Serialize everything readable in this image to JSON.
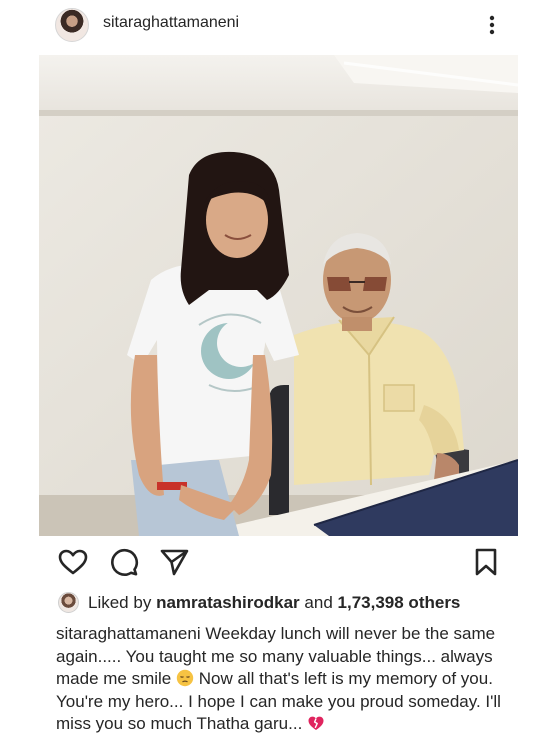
{
  "post": {
    "username": "sitaraghattamaneni"
  },
  "likes": {
    "prefix": "Liked by",
    "user": "namratashirodkar",
    "middle": "and",
    "count": "1,73,398 others"
  },
  "caption": {
    "username": "sitaraghattamaneni",
    "text_1": " Weekday lunch will never be the same again..... You taught me so many valuable things... always made me smile ",
    "emoji_1": "pensive-face-emoji",
    "text_2": " Now all that's left is my memory of you. You're my hero... I hope I can make you proud someday. I'll miss you so much Thatha garu... ",
    "emoji_2": "broken-heart-emoji"
  },
  "icons": {
    "more": "more-vertical-icon",
    "like": "heart-icon",
    "comment": "comment-icon",
    "share": "send-icon",
    "save": "bookmark-icon"
  },
  "colors": {
    "text": "#262626",
    "broken_heart": "#e0245e",
    "emoji_face": "#f6c343"
  }
}
